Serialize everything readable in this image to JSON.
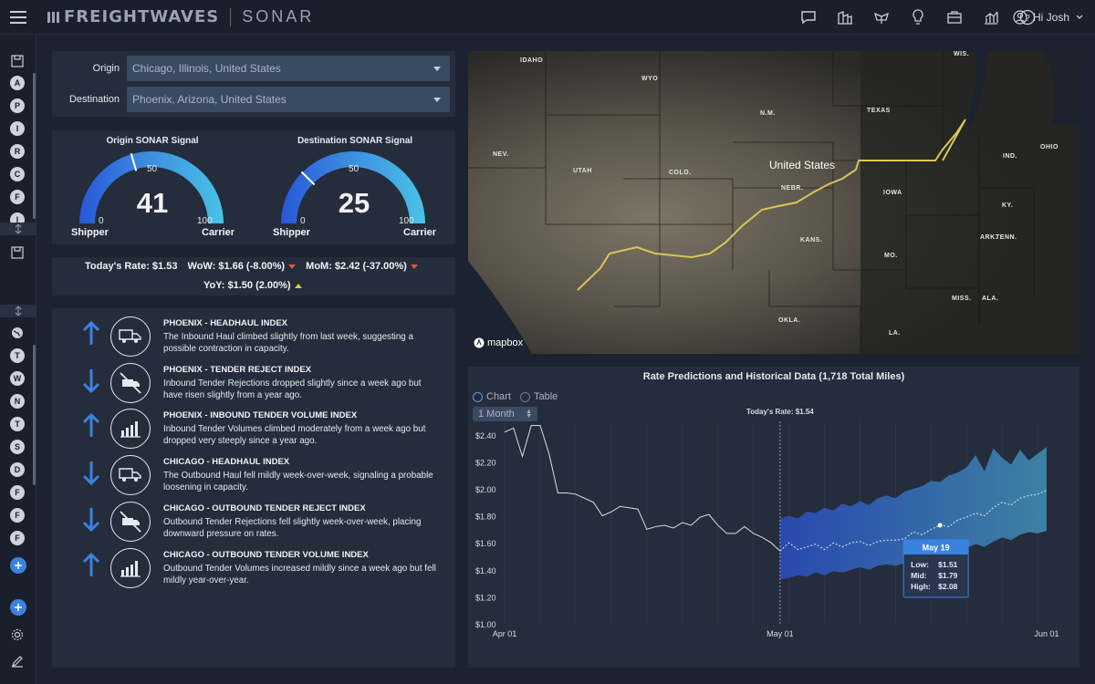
{
  "brand": {
    "primary": "FREIGHTWAVES",
    "product": "SONAR"
  },
  "header": {
    "icons": [
      "chat-icon",
      "buildings-icon",
      "ship-icon",
      "lightbulb-icon",
      "briefcase-icon",
      "bar-chart-icon",
      "help-icon"
    ],
    "user_label": "Hi Josh"
  },
  "sidebar": {
    "letters_top": [
      "A",
      "P",
      "I",
      "R",
      "C",
      "F",
      "I"
    ],
    "letters_bottom": [
      "T",
      "W",
      "N",
      "T",
      "S",
      "D",
      "F",
      "F",
      "F"
    ]
  },
  "lane": {
    "origin_label": "Origin",
    "origin_value": "Chicago, Illinois, United States",
    "destination_label": "Destination",
    "destination_value": "Phoenix, Arizona, United States"
  },
  "gauges": [
    {
      "title": "Origin SONAR Signal",
      "value": "41",
      "mid": "50",
      "min": "0",
      "max": "100",
      "left_label": "Shipper",
      "right_label": "Carrier",
      "level": 41
    },
    {
      "title": "Destination SONAR Signal",
      "value": "25",
      "mid": "50",
      "min": "0",
      "max": "100",
      "left_label": "Shipper",
      "right_label": "Carrier",
      "level": 25
    }
  ],
  "rates": {
    "today": "Today's Rate: $1.53",
    "wow": "WoW: $1.66 (-8.00%)",
    "mom": "MoM: $2.42 (-37.00%)",
    "yoy": "YoY: $1.50 (2.00%)"
  },
  "indices": [
    {
      "direction": "up",
      "icon": "truck-icon",
      "title": "PHOENIX - HEADHAUL INDEX",
      "desc": "The Inbound Haul climbed slightly from last week, suggesting a possible contraction in capacity."
    },
    {
      "direction": "down",
      "icon": "truck-reject-icon",
      "title": "PHOENIX - TENDER REJECT INDEX",
      "desc": "Inbound Tender Rejections dropped slightly since a week ago but have risen slightly from a year ago."
    },
    {
      "direction": "up",
      "icon": "volume-bars-icon",
      "title": "PHOENIX - INBOUND TENDER VOLUME INDEX",
      "desc": "Inbound Tender Volumes climbed moderately from a week ago but dropped very steeply since a year ago."
    },
    {
      "direction": "down",
      "icon": "truck-icon",
      "title": "CHICAGO - HEADHAUL INDEX",
      "desc": "The Outbound Haul fell mildly week-over-week, signaling a probable loosening in capacity."
    },
    {
      "direction": "down",
      "icon": "truck-reject-icon",
      "title": "CHICAGO - OUTBOUND TENDER REJECT INDEX",
      "desc": "Outbound Tender Rejections fell slightly week-over-week, placing downward pressure on rates."
    },
    {
      "direction": "up",
      "icon": "volume-bars-icon",
      "title": "CHICAGO - OUTBOUND TENDER VOLUME INDEX",
      "desc": "Outbound Tender Volumes increased mildly since a week ago but fell mildly year-over-year."
    }
  ],
  "map": {
    "country": "United States",
    "states": [
      "IDAHO",
      "WYO",
      "NEV.",
      "UTAH",
      "COLO.",
      "N.M.",
      "NEBR.",
      "KANS.",
      "OKLA.",
      "TEXAS",
      "IOWA",
      "MO.",
      "ARK.",
      "MISS.",
      "ALA.",
      "LA.",
      "TENN.",
      "KY.",
      "IND.",
      "OHIO",
      "WIS."
    ],
    "attribution": "mapbox"
  },
  "chart_panel": {
    "title": "Rate Predictions and Historical Data (1,718 Total Miles)",
    "view_chart": "Chart",
    "view_table": "Table",
    "period": "1 Month"
  },
  "chart_data": {
    "type": "line",
    "title": "Rate Predictions and Historical Data (1,718 Total Miles)",
    "x_ticks": [
      "Apr 01",
      "May 01",
      "Jun 01"
    ],
    "y_ticks": [
      "$2.40",
      "$2.20",
      "$2.00",
      "$1.80",
      "$1.60",
      "$1.40",
      "$1.20",
      "$1.00"
    ],
    "ylim": [
      1.0,
      2.5
    ],
    "today_marker": {
      "x": 31,
      "label": "Today's Rate: $1.54"
    },
    "series": [
      {
        "kind": "historical",
        "x": [
          0,
          1,
          2,
          3,
          4,
          5,
          6,
          7,
          8,
          9,
          10,
          11,
          12,
          13,
          14,
          15,
          16,
          17,
          18,
          19,
          20,
          21,
          22,
          23,
          24,
          25,
          26,
          27,
          28,
          29,
          30,
          31
        ],
        "values": [
          2.42,
          2.45,
          2.24,
          2.47,
          2.47,
          2.26,
          1.97,
          1.97,
          1.96,
          1.93,
          1.9,
          1.8,
          1.83,
          1.87,
          1.86,
          1.85,
          1.7,
          1.72,
          1.73,
          1.71,
          1.75,
          1.73,
          1.79,
          1.81,
          1.73,
          1.67,
          1.67,
          1.72,
          1.67,
          1.64,
          1.6,
          1.54
        ]
      },
      {
        "kind": "prediction",
        "x": [
          31,
          32,
          33,
          34,
          35,
          36,
          37,
          38,
          39,
          40,
          41,
          42,
          43,
          44,
          45,
          46,
          47,
          48,
          49,
          50,
          51,
          52,
          53,
          54,
          55,
          56,
          57,
          58,
          59,
          60,
          61
        ],
        "mid": [
          1.54,
          1.6,
          1.55,
          1.57,
          1.59,
          1.55,
          1.6,
          1.57,
          1.6,
          1.61,
          1.58,
          1.61,
          1.62,
          1.62,
          1.63,
          1.68,
          1.66,
          1.7,
          1.73,
          1.72,
          1.77,
          1.79,
          1.82,
          1.8,
          1.86,
          1.9,
          1.88,
          1.93,
          1.95,
          1.96,
          1.99
        ],
        "low": [
          1.33,
          1.34,
          1.36,
          1.35,
          1.38,
          1.36,
          1.39,
          1.38,
          1.4,
          1.42,
          1.4,
          1.43,
          1.44,
          1.43,
          1.45,
          1.48,
          1.46,
          1.49,
          1.52,
          1.5,
          1.54,
          1.56,
          1.59,
          1.57,
          1.61,
          1.64,
          1.62,
          1.66,
          1.68,
          1.67,
          1.69
        ],
        "high": [
          1.78,
          1.8,
          1.78,
          1.83,
          1.82,
          1.86,
          1.84,
          1.89,
          1.87,
          1.91,
          1.88,
          1.93,
          1.95,
          1.93,
          1.98,
          2.0,
          2.02,
          2.06,
          2.05,
          2.1,
          2.12,
          2.16,
          2.25,
          2.13,
          2.3,
          2.23,
          2.18,
          2.29,
          2.21,
          2.26,
          2.31
        ]
      }
    ],
    "tooltip": {
      "date": "May 19",
      "low_label": "Low:",
      "low": "$1.51",
      "mid_label": "Mid:",
      "mid": "$1.79",
      "high_label": "High:",
      "high": "$2.08",
      "x": 49
    }
  }
}
